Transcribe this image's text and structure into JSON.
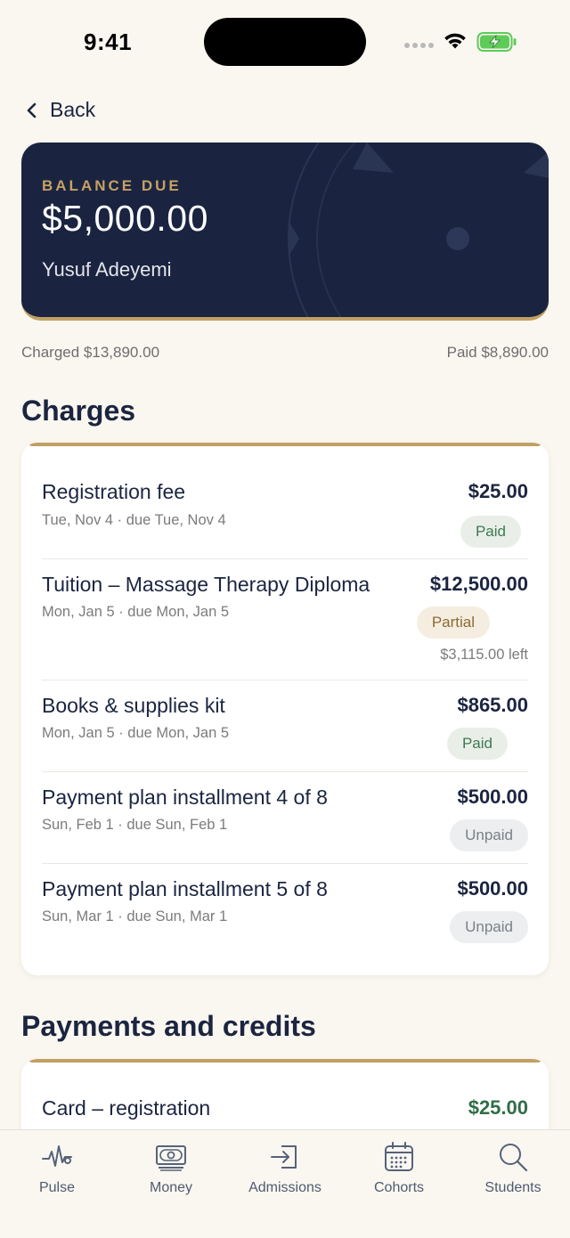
{
  "status": {
    "time": "9:41"
  },
  "nav": {
    "back_label": "Back"
  },
  "balance": {
    "label": "BALANCE DUE",
    "amount": "$5,000.00",
    "student_name": "Yusuf Adeyemi",
    "charged": "Charged $13,890.00",
    "paid": "Paid $8,890.00"
  },
  "charges": {
    "title": "Charges",
    "items": [
      {
        "title": "Registration fee",
        "sub": "Tue, Nov 4 · due Tue, Nov 4",
        "amount": "$25.00",
        "status": "Paid"
      },
      {
        "title": "Tuition – Massage Therapy Diploma",
        "sub": "Mon, Jan 5 · due Mon, Jan 5",
        "amount": "$12,500.00",
        "status": "Partial",
        "left": "$3,115.00 left"
      },
      {
        "title": "Books & supplies kit",
        "sub": "Mon, Jan 5 · due Mon, Jan 5",
        "amount": "$865.00",
        "status": "Paid"
      },
      {
        "title": "Payment plan installment 4 of 8",
        "sub": "Sun, Feb 1 · due Sun, Feb 1",
        "amount": "$500.00",
        "status": "Unpaid"
      },
      {
        "title": "Payment plan installment 5 of 8",
        "sub": "Sun, Mar 1 · due Sun, Mar 1",
        "amount": "$500.00",
        "status": "Unpaid"
      }
    ]
  },
  "payments": {
    "title": "Payments and credits",
    "items": [
      {
        "title": "Card – registration",
        "amount": "$25.00"
      }
    ]
  },
  "tabs": [
    {
      "label": "Pulse",
      "icon": "pulse-icon"
    },
    {
      "label": "Money",
      "icon": "money-icon"
    },
    {
      "label": "Admissions",
      "icon": "admissions-icon"
    },
    {
      "label": "Cohorts",
      "icon": "calendar-icon"
    },
    {
      "label": "Students",
      "icon": "search-icon"
    }
  ],
  "colors": {
    "background": "#faf7f0",
    "navy": "#1a2441",
    "gold": "#c1a064",
    "paid_green": "#3d7a52",
    "payment_green": "#2f6e46"
  }
}
